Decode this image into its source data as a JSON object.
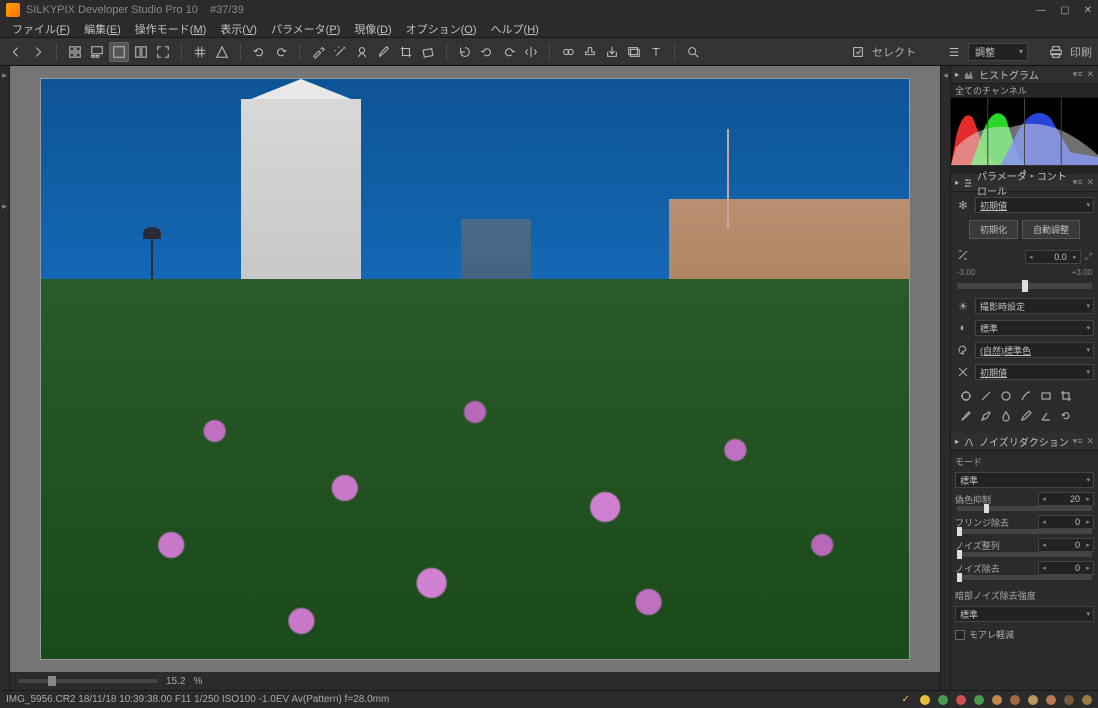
{
  "titlebar": {
    "app": "SILKYPIX Developer Studio Pro 10",
    "counter": "#37/39"
  },
  "menus": [
    "ファイル(F)",
    "編集(E)",
    "操作モード(M)",
    "表示(V)",
    "パラメータ(P)",
    "現像(D)",
    "オプション(O)",
    "ヘルプ(H)"
  ],
  "toolbar_right": {
    "select_label": "セレクト",
    "dropdown_prefix": "調整",
    "print_label": "印刷"
  },
  "zoombar": {
    "percent": "15.2",
    "unit": "%"
  },
  "panels": {
    "histogram": {
      "title": "ヒストグラム",
      "channel": "全てのチャンネル"
    },
    "param": {
      "title": "パラメータ・コントロール",
      "preset": "初期値",
      "btn_init": "初期化",
      "btn_auto": "自動調整",
      "exposure_val": "0.0",
      "exp_min": "-3.00",
      "exp_max": "+3.00",
      "rows": {
        "shooting": "撮影時設定",
        "contrast": "標準",
        "color": "(自然)標準色",
        "sharp": "初期値"
      }
    },
    "noise": {
      "title": "ノイズリダクション",
      "mode_label": "モード",
      "mode_val": "標準",
      "items": [
        {
          "label": "偽色抑制",
          "val": "20",
          "pos": 20
        },
        {
          "label": "フリンジ除去",
          "val": "0",
          "pos": 0
        },
        {
          "label": "ノイズ整列",
          "val": "0",
          "pos": 0
        },
        {
          "label": "ノイズ除去",
          "val": "0",
          "pos": 0
        }
      ],
      "dark_label": "暗部ノイズ除去強度",
      "dark_val": "標準",
      "moire": "モアレ軽減"
    }
  },
  "status": "IMG_5956.CR2 18/11/18 10:39:38.00 F11 1/250 ISO100 -1.0EV Av(Pattern) f=28.0mm",
  "status_colors": [
    "#e8c040",
    "#4a9a4a",
    "#d05050",
    "#4a9a4a",
    "#c08850",
    "#a06840",
    "#b89860",
    "#b87850",
    "#7a5a3a",
    "#9a7a40"
  ]
}
